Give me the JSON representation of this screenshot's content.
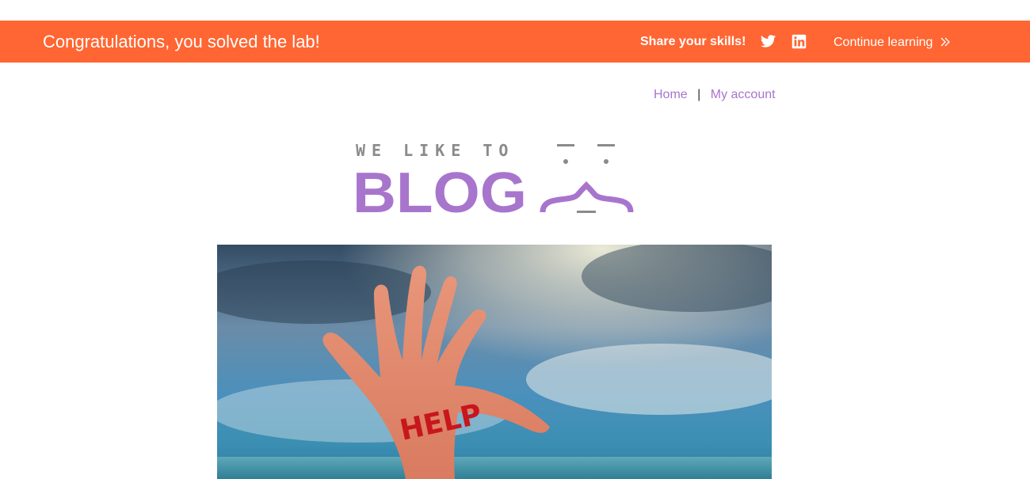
{
  "banner": {
    "message": "Congratulations, you solved the lab!",
    "share_label": "Share your skills!",
    "social_icons": [
      "twitter-icon",
      "linkedin-icon"
    ],
    "continue_label": "Continue learning",
    "background_color": "#ff6633"
  },
  "nav": {
    "home_label": "Home",
    "separator": "|",
    "account_label": "My account",
    "link_color": "#a875cd"
  },
  "logo": {
    "line1": "WE LIKE TO",
    "line2": "BLOG",
    "accent_color": "#a875cd"
  },
  "hero": {
    "hand_text": "HELP"
  }
}
